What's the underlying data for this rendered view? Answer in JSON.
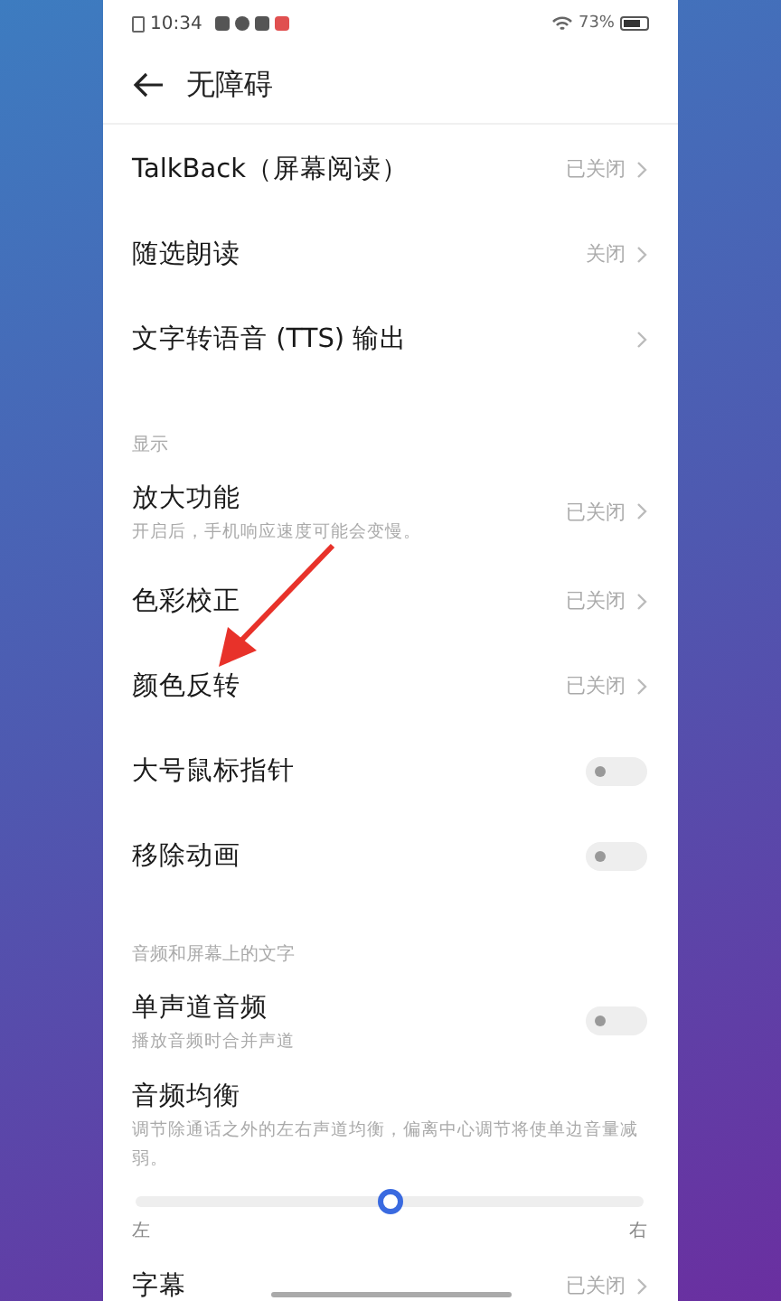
{
  "status_bar": {
    "time": "10:34",
    "battery_text": "73%"
  },
  "header": {
    "title": "无障碍"
  },
  "sections": [
    {
      "items": [
        {
          "kind": "link",
          "label": "TalkBack（屏幕阅读）",
          "value": "已关闭"
        },
        {
          "kind": "link",
          "label": "随选朗读",
          "value": "关闭"
        },
        {
          "kind": "link",
          "label": "文字转语音 (TTS) 输出"
        }
      ]
    },
    {
      "title": "显示",
      "items": [
        {
          "kind": "link",
          "label": "放大功能",
          "description": "开启后，手机响应速度可能会变慢。",
          "value": "已关闭"
        },
        {
          "kind": "link",
          "label": "色彩校正",
          "value": "已关闭"
        },
        {
          "kind": "link",
          "label": "颜色反转",
          "value": "已关闭"
        },
        {
          "kind": "toggle",
          "label": "大号鼠标指针",
          "on": false
        },
        {
          "kind": "toggle",
          "label": "移除动画",
          "on": false
        }
      ]
    },
    {
      "title": "音频和屏幕上的文字",
      "items": [
        {
          "kind": "toggle",
          "label": "单声道音频",
          "description": "播放音频时合并声道",
          "on": false
        },
        {
          "kind": "slider",
          "label": "音频均衡",
          "description": "调节除通话之外的左右声道均衡，偏离中心调节将使单边音量减弱。",
          "level": 0.5,
          "min_label": "左",
          "max_label": "右"
        },
        {
          "kind": "link",
          "label": "字幕",
          "value": "已关闭"
        }
      ]
    }
  ]
}
